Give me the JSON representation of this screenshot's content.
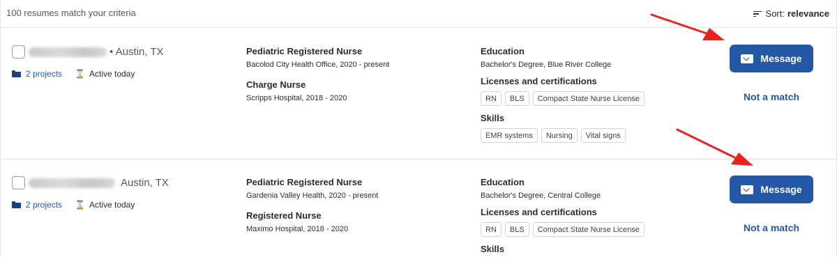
{
  "header": {
    "result_count": "100 resumes match your criteria",
    "sort_label": "Sort:",
    "sort_value": "relevance",
    "sort_icon": "sort-lines-icon"
  },
  "candidates": [
    {
      "location": "• Austin, TX",
      "projects": "2 projects",
      "activity": "Active today",
      "jobs": [
        {
          "title": "Pediatric Registered Nurse",
          "detail": "Bacolod City Health Office, 2020 - present"
        },
        {
          "title": "Charge Nurse",
          "detail": "Scripps Hospital, 2018 - 2020"
        }
      ],
      "education_title": "Education",
      "education_detail": "Bachelor's Degree, Blue River College",
      "licenses_title": "Licenses and certifications",
      "licenses": [
        "RN",
        "BLS",
        "Compact State Nurse License"
      ],
      "skills_title": "Skills",
      "skills": [
        "EMR systems",
        "Nursing",
        "Vital signs"
      ],
      "message_label": "Message",
      "not_match_label": "Not a match"
    },
    {
      "location": "Austin, TX",
      "projects": "2 projects",
      "activity": "Active today",
      "jobs": [
        {
          "title": "Pediatric Registered Nurse",
          "detail": "Gardenia Valley Health, 2020 - present"
        },
        {
          "title": "Registered Nurse",
          "detail": "Maximo Hospital, 2018 - 2020"
        }
      ],
      "education_title": "Education",
      "education_detail": "Bachelor's Degree, Central College",
      "licenses_title": "Licenses and certifications",
      "licenses": [
        "RN",
        "BLS",
        "Compact State Nurse License"
      ],
      "skills_title": "Skills",
      "message_label": "Message",
      "not_match_label": "Not a match"
    }
  ],
  "colors": {
    "primary": "#2557a7",
    "annotation_arrow": "#e8231f",
    "border": "#e4e2e0"
  }
}
